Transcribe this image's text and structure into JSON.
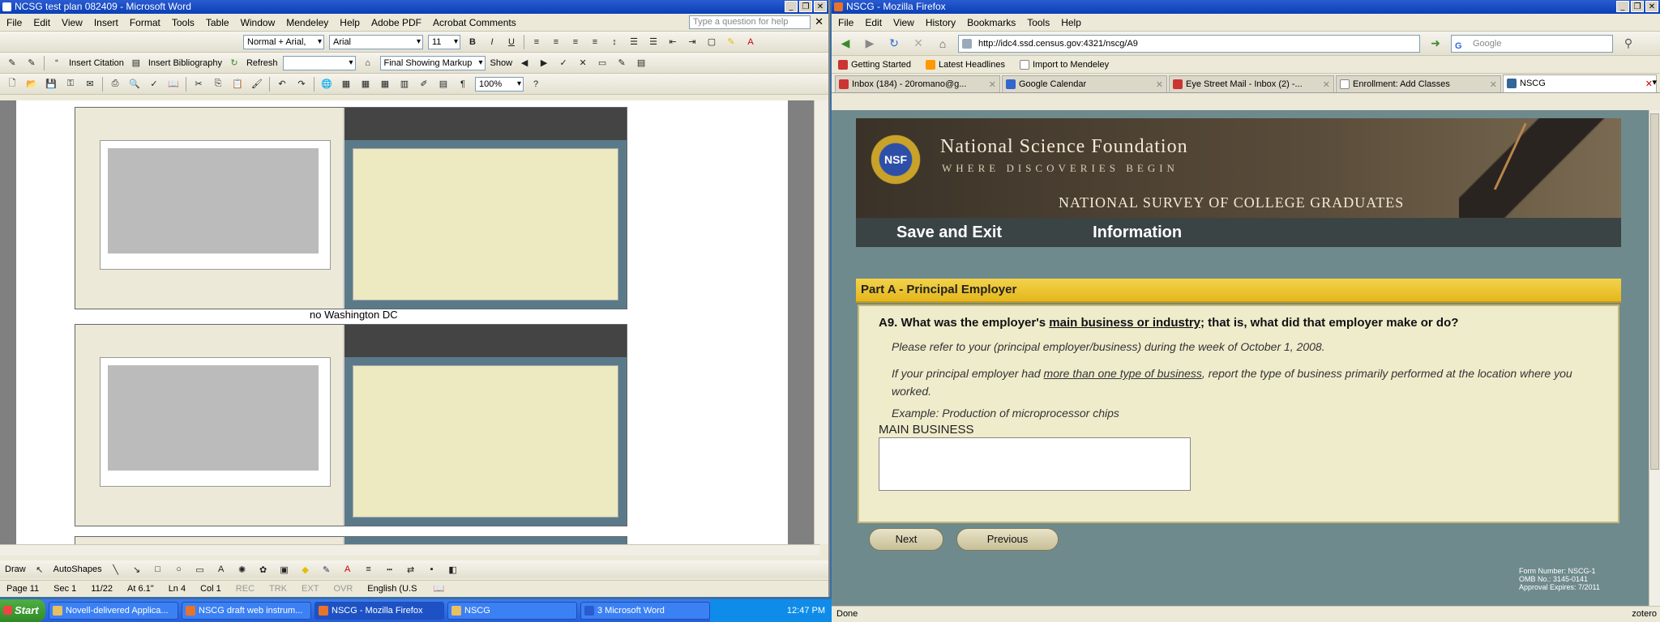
{
  "word": {
    "title": "NCSG test plan 082409 - Microsoft Word",
    "menu": [
      "File",
      "Edit",
      "View",
      "Insert",
      "Format",
      "Tools",
      "Table",
      "Window",
      "Mendeley",
      "Help",
      "Adobe PDF",
      "Acrobat Comments"
    ],
    "question_placeholder": "Type a question for help",
    "style_combo": "Normal + Arial,",
    "font_combo": "Arial",
    "size_combo": "11",
    "insert_citation": "Insert Citation",
    "insert_bibliography": "Insert Bibliography",
    "refresh": "Refresh",
    "markup_combo": "Final Showing Markup",
    "show_btn": "Show",
    "zoom_combo": "100%",
    "caption": "no Washington DC",
    "draw_label": "Draw",
    "autoshapes_label": "AutoShapes",
    "status": {
      "page": "Page 11",
      "sec": "Sec 1",
      "pages": "11/22",
      "at": "At 6.1\"",
      "ln": "Ln 4",
      "col": "Col 1",
      "rec": "REC",
      "trk": "TRK",
      "ext": "EXT",
      "ovr": "OVR",
      "lang": "English (U.S"
    }
  },
  "firefox": {
    "title": "NSCG - Mozilla Firefox",
    "menu": [
      "File",
      "Edit",
      "View",
      "History",
      "Bookmarks",
      "Tools",
      "Help"
    ],
    "url": "http://idc4.ssd.census.gov:4321/nscg/A9",
    "search_placeholder": "Google",
    "bookmarks": [
      "Getting Started",
      "Latest Headlines",
      "Import to Mendeley"
    ],
    "tabs": [
      "Inbox (184) - 20romano@g...",
      "Google Calendar",
      "Eye Street Mail - Inbox (2) -...",
      "Enrollment: Add Classes",
      "NSCG"
    ],
    "status": "Done",
    "zotero": "zotero"
  },
  "page": {
    "org_name": "National Science Foundation",
    "org_tagline": "WHERE DISCOVERIES BEGIN",
    "logo_text": "NSF",
    "survey_title": "NATIONAL SURVEY OF COLLEGE GRADUATES",
    "nav_save": "Save and Exit",
    "nav_info": "Information",
    "part_title": "Part A - Principal Employer",
    "q_prefix": "A9. What was the employer's ",
    "q_underline": "main business or industry",
    "q_suffix": "; that is, what did that employer make or do?",
    "instr1": "Please refer to your (principal employer/business) during the week of October 1, 2008.",
    "instr2_prefix": "If your principal employer had ",
    "instr2_underline": "more than one type of business",
    "instr2_suffix": ", report the type of business primarily performed at the location where you worked.",
    "instr3": "Example: Production of microprocessor chips",
    "field_label": "MAIN BUSINESS",
    "next_btn": "Next",
    "prev_btn": "Previous",
    "form_number": "Form Number: NSCG-1",
    "omb": "OMB No.: 3145-0141",
    "approval": "Approval Expires: 7/2011"
  },
  "taskbar": {
    "start": "Start",
    "tasks": [
      "Novell-delivered Applica...",
      "NSCG draft web instrum...",
      "NSCG - Mozilla Firefox",
      "NSCG",
      "3 Microsoft Word"
    ],
    "clock": "12:47 PM"
  }
}
